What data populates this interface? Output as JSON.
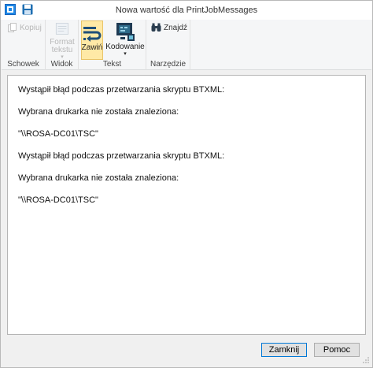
{
  "window": {
    "title": "Nowa wartość dla PrintJobMessages"
  },
  "ribbon": {
    "schowek": {
      "label": "Schowek",
      "copy_label": "Kopiuj"
    },
    "widok": {
      "label": "Widok",
      "view_label_1": "Format",
      "view_label_2": "tekstu"
    },
    "tekst": {
      "label": "Tekst",
      "wrap_label": "Zawiń",
      "encoding_label": "Kodowanie"
    },
    "narzedzie": {
      "label": "Narzędzie",
      "find_label": "Znajdź"
    }
  },
  "content": {
    "lines": [
      "Wystąpił błąd podczas przetwarzania skryptu BTXML:",
      "Wybrana drukarka nie została znaleziona:",
      "\"\\\\ROSA-DC01\\TSC\"",
      "Wystąpił błąd podczas przetwarzania skryptu BTXML:",
      "Wybrana drukarka nie została znaleziona:",
      "\"\\\\ROSA-DC01\\TSC\""
    ]
  },
  "footer": {
    "close_label": "Zamknij",
    "help_label": "Pomoc"
  },
  "colors": {
    "accent": "#0078d7",
    "active_button": "#ffe9a6"
  }
}
